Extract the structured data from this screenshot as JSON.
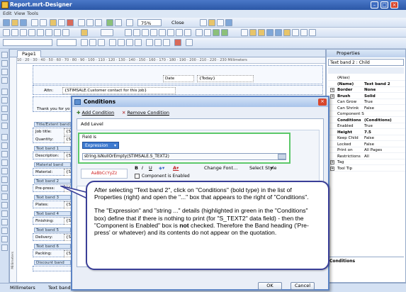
{
  "window": {
    "title": "Report.mrt-Designer"
  },
  "menu": [
    "Edit",
    "View",
    "Tools"
  ],
  "toolbar": {
    "zoom": "75%",
    "close_label": "Close"
  },
  "designer": {
    "page_tab": "Page1",
    "ruler": "10 · 20 · 30 · 40 · 50 · 60 · 70 · 80 · 90 · 100 · 110 · 120 · 130 · 140 · 150 · 160 · 170 · 180 · 190 · 200 · 210 · 220 · 230 Millimeters",
    "date_label": "Date",
    "today_field": "{Today}",
    "attn_label": "Attn:",
    "attn_field": "{STIMSALE.Customer contact for this job}",
    "thanks_label": "Thank you for yo",
    "bands": [
      {
        "name": "Title/Extent band",
        "rows": [
          [
            "Job title:",
            "{ST"
          ],
          [
            "Quantity:",
            "{ST"
          ]
        ]
      },
      {
        "name": "Text band 1",
        "rows": [
          [
            "Description:",
            "{ST"
          ]
        ]
      },
      {
        "name": "Material band",
        "rows": [
          [
            "Material:",
            "{ST"
          ]
        ]
      },
      {
        "name": "Text band 2",
        "rows": [
          [
            "Pre-press:",
            "{ST"
          ]
        ]
      },
      {
        "name": "Text band 3",
        "rows": [
          [
            "Plates:",
            "{ST"
          ]
        ]
      },
      {
        "name": "Text band 4",
        "rows": [
          [
            "Finishing:",
            "{ST"
          ]
        ]
      },
      {
        "name": "Text band 5",
        "rows": [
          [
            "Delivery:",
            "{ST"
          ]
        ]
      },
      {
        "name": "Text band 6",
        "rows": [
          [
            "Packing:",
            "{ST"
          ]
        ]
      },
      {
        "name": "Discount band",
        "rows": []
      }
    ]
  },
  "properties": {
    "title": "Properties",
    "selected": "Text band 2 : Child",
    "rows": [
      {
        "k": "(Alias)",
        "v": "",
        "bold": false
      },
      {
        "k": "(Name)",
        "v": "Text band 2",
        "bold": true
      },
      {
        "k": "Border",
        "v": "None",
        "bold": true,
        "expand": true
      },
      {
        "k": "Brush",
        "v": "Solid",
        "bold": true,
        "expand": true
      },
      {
        "k": "Can Grow",
        "v": "True",
        "bold": false
      },
      {
        "k": "Can Shrink",
        "v": "False",
        "bold": false
      },
      {
        "k": "Component St",
        "v": "",
        "bold": false
      },
      {
        "k": "Conditions",
        "v": "(Conditions)",
        "bold": true
      },
      {
        "k": "Enabled",
        "v": "True",
        "bold": false
      },
      {
        "k": "Height",
        "v": "7.5",
        "bold": true
      },
      {
        "k": "Keep Child",
        "v": "False",
        "bold": false
      },
      {
        "k": "Locked",
        "v": "False",
        "bold": false
      },
      {
        "k": "Print on",
        "v": "All Pages",
        "bold": false
      },
      {
        "k": "Restrictions",
        "v": "All",
        "bold": false
      },
      {
        "k": "Tag",
        "v": "",
        "bold": false,
        "expand": true
      },
      {
        "k": "Tool Tip",
        "v": "",
        "bold": false,
        "expand": true
      }
    ],
    "description": "Conditions"
  },
  "status": {
    "units": "Millimeters",
    "component": "Text band 2"
  },
  "dialog": {
    "title": "Conditions",
    "add_condition": "Add Condition",
    "remove_condition": "Remove Condition",
    "add_level": "Add Level",
    "field_is": "Field is",
    "field_type": "Expression",
    "expression": "string.IsNullOrEmpty(STIMSALE.S_TEXT2)",
    "sample": "AaBbCcYyZz",
    "change_font": "Change Font...",
    "select_style": "Select Style",
    "component_enabled": "Component is Enabled",
    "ok": "OK",
    "cancel": "Cancel"
  },
  "callout": {
    "p1": "After selecting \"Text band 2\", click on \"Conditions\" (bold type) in the list of Properties (right) and open the \"...\" box that appears to the right of \"Conditions\".",
    "p2a": "The \"Expression\" and \"string ...\" details (highlighted in green in the \"Conditions\" box) define that if there is nothing to print (for \"S_TEXT2\" data field) - then the \"Component is Enabled\" box is ",
    "p2b": "not",
    "p2c": " checked. Therefore the Band heading ('Pre-press' or whatever) and its contents do not appear on the quotation."
  }
}
